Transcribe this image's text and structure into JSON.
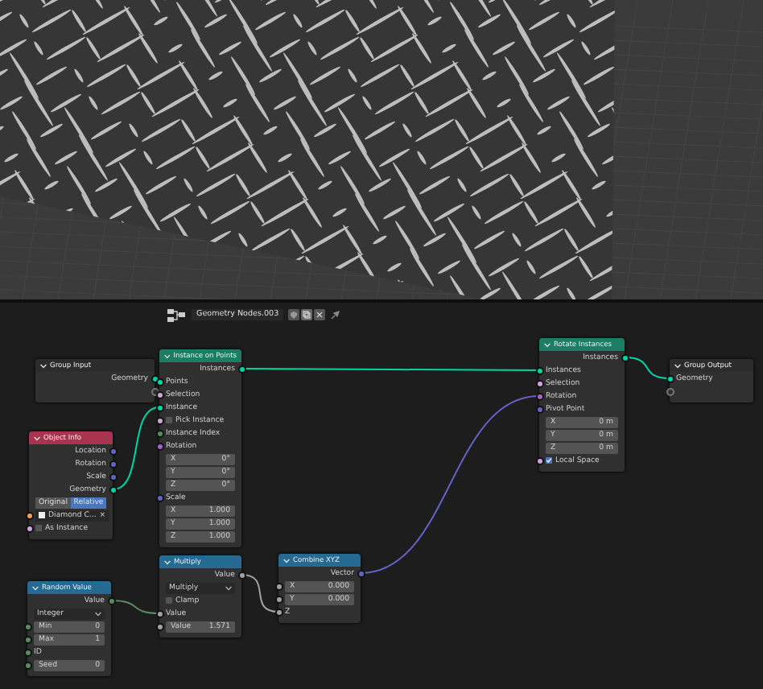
{
  "editor_header": {
    "node_group": "Geometry Nodes.003"
  },
  "nodes": [
    {
      "title": "Group Input",
      "color": "#2c2c2c",
      "rows": [
        {
          "kind": "output",
          "label": "Geometry",
          "color": "#00d6a3"
        },
        {
          "kind": "virtual_output"
        }
      ]
    },
    {
      "title": "Instance on Points",
      "color": "#1d7c64",
      "rows": [
        {
          "kind": "output",
          "label": "Instances",
          "color": "#00d6a3"
        },
        {
          "kind": "input",
          "label": "Points",
          "color": "#00d6a3"
        },
        {
          "kind": "input",
          "label": "Selection",
          "color": "#cca6d6"
        },
        {
          "kind": "input",
          "label": "Instance",
          "color": "#00d6a3"
        },
        {
          "kind": "checkbox",
          "label": "Pick Instance",
          "checked": false,
          "color": "#cca6d6"
        },
        {
          "kind": "input",
          "label": "Instance Index",
          "color": "#598c5c"
        },
        {
          "kind": "input",
          "label": "Rotation",
          "color": "#a363c7"
        },
        {
          "kind": "field",
          "label": "X",
          "value": "0°"
        },
        {
          "kind": "field",
          "label": "Y",
          "value": "0°"
        },
        {
          "kind": "field",
          "label": "Z",
          "value": "0°"
        },
        {
          "kind": "input",
          "label": "Scale",
          "color": "#6363c7"
        },
        {
          "kind": "field",
          "label": "X",
          "value": "1.000"
        },
        {
          "kind": "field",
          "label": "Y",
          "value": "1.000"
        },
        {
          "kind": "field",
          "label": "Z",
          "value": "1.000"
        }
      ]
    },
    {
      "title": "Object Info",
      "color": "#a8344f",
      "rows": [
        {
          "kind": "output",
          "label": "Location",
          "color": "#6363c7"
        },
        {
          "kind": "output",
          "label": "Rotation",
          "color": "#6363c7"
        },
        {
          "kind": "output",
          "label": "Scale",
          "color": "#6363c7"
        },
        {
          "kind": "output",
          "label": "Geometry",
          "color": "#00d6a3"
        },
        {
          "kind": "segmented",
          "options": [
            {
              "label": "Original",
              "selected": false
            },
            {
              "label": "Relative",
              "selected": true
            }
          ]
        },
        {
          "kind": "object",
          "value": "Diamond C...",
          "clear": "×",
          "color": "#ed9e5c"
        },
        {
          "kind": "checkbox",
          "label": "As Instance",
          "checked": false,
          "color": "#cca6d6"
        }
      ]
    },
    {
      "title": "Rotate Instances",
      "color": "#1d7c64",
      "rows": [
        {
          "kind": "output",
          "label": "Instances",
          "color": "#00d6a3"
        },
        {
          "kind": "input",
          "label": "Instances",
          "color": "#00d6a3"
        },
        {
          "kind": "input",
          "label": "Selection",
          "color": "#cca6d6"
        },
        {
          "kind": "input",
          "label": "Rotation",
          "color": "#a363c7"
        },
        {
          "kind": "input",
          "label": "Pivot Point",
          "color": "#6363c7"
        },
        {
          "kind": "field",
          "label": "X",
          "value": "0 m"
        },
        {
          "kind": "field",
          "label": "Y",
          "value": "0 m"
        },
        {
          "kind": "field",
          "label": "Z",
          "value": "0 m"
        },
        {
          "kind": "checkbox",
          "label": "Local Space",
          "checked": true,
          "color": "#cca6d6"
        }
      ]
    },
    {
      "title": "Group Output",
      "color": "#2c2c2c",
      "rows": [
        {
          "kind": "input",
          "label": "Geometry",
          "color": "#00d6a3"
        },
        {
          "kind": "virtual_input"
        }
      ]
    },
    {
      "title": "Random Value",
      "color": "#246a93",
      "rows": [
        {
          "kind": "output",
          "label": "Value",
          "color": "#598c5c"
        },
        {
          "kind": "dropdown",
          "value": "Integer"
        },
        {
          "kind": "field",
          "label": "Min",
          "value": "0",
          "color": "#598c5c"
        },
        {
          "kind": "field",
          "label": "Max",
          "value": "1",
          "color": "#598c5c"
        },
        {
          "kind": "input",
          "label": "ID",
          "color": "#598c5c"
        },
        {
          "kind": "field",
          "label": "Seed",
          "value": "0",
          "color": "#598c5c"
        }
      ]
    },
    {
      "title": "Multiply",
      "color": "#246a93",
      "rows": [
        {
          "kind": "output",
          "label": "Value",
          "color": "#a1a1a1"
        },
        {
          "kind": "dropdown",
          "value": "Multiply"
        },
        {
          "kind": "checkbox",
          "label": "Clamp",
          "checked": false
        },
        {
          "kind": "input",
          "label": "Value",
          "color": "#a1a1a1"
        },
        {
          "kind": "field",
          "label": "Value",
          "value": "1.571",
          "color": "#a1a1a1"
        }
      ]
    },
    {
      "title": "Combine XYZ",
      "color": "#246a93",
      "rows": [
        {
          "kind": "output",
          "label": "Vector",
          "color": "#6363c7"
        },
        {
          "kind": "field",
          "label": "X",
          "value": "0.000",
          "color": "#a1a1a1"
        },
        {
          "kind": "field",
          "label": "Y",
          "value": "0.000",
          "color": "#a1a1a1"
        },
        {
          "kind": "input",
          "label": "Z",
          "color": "#a1a1a1"
        }
      ]
    }
  ]
}
